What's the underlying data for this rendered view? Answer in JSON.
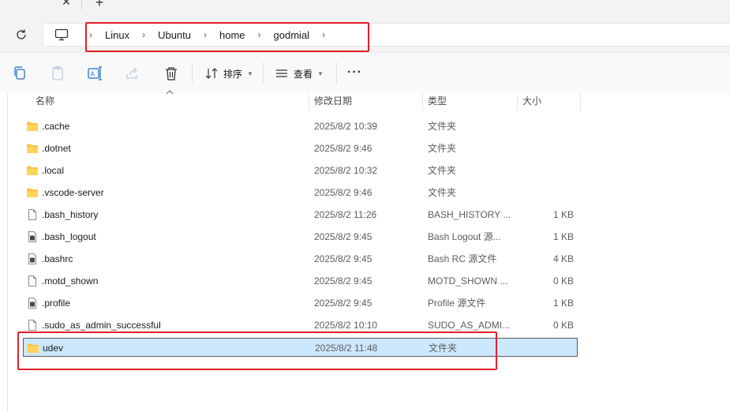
{
  "tabs": {
    "close_glyph": "✕",
    "new_glyph": "+"
  },
  "breadcrumb": {
    "items": [
      "Linux",
      "Ubuntu",
      "home",
      "godmial"
    ],
    "separator": "›"
  },
  "toolbar": {
    "sort_label": "排序",
    "view_label": "查看",
    "more_glyph": "···",
    "icons": [
      "copy-icon",
      "paste-icon",
      "rename-icon",
      "share-icon",
      "delete-icon",
      "sort-icon",
      "view-icon"
    ]
  },
  "columns": {
    "name": "名称",
    "date": "修改日期",
    "type": "类型",
    "size": "大小"
  },
  "files": [
    {
      "name": ".cache",
      "date": "2025/8/2 10:39",
      "type": "文件夹",
      "size": "",
      "icon": "folder-icon"
    },
    {
      "name": ".dotnet",
      "date": "2025/8/2 9:46",
      "type": "文件夹",
      "size": "",
      "icon": "folder-icon"
    },
    {
      "name": ".local",
      "date": "2025/8/2 10:32",
      "type": "文件夹",
      "size": "",
      "icon": "folder-icon"
    },
    {
      "name": ".vscode-server",
      "date": "2025/8/2 9:46",
      "type": "文件夹",
      "size": "",
      "icon": "folder-icon"
    },
    {
      "name": ".bash_history",
      "date": "2025/8/2 11:26",
      "type": "BASH_HISTORY ...",
      "size": "1 KB",
      "icon": "file-icon"
    },
    {
      "name": ".bash_logout",
      "date": "2025/8/2 9:45",
      "type": "Bash Logout 源...",
      "size": "1 KB",
      "icon": "source-file-icon"
    },
    {
      "name": ".bashrc",
      "date": "2025/8/2 9:45",
      "type": "Bash RC 源文件",
      "size": "4 KB",
      "icon": "source-file-icon"
    },
    {
      "name": ".motd_shown",
      "date": "2025/8/2 9:45",
      "type": "MOTD_SHOWN ...",
      "size": "0 KB",
      "icon": "file-icon"
    },
    {
      "name": ".profile",
      "date": "2025/8/2 9:45",
      "type": "Profile 源文件",
      "size": "1 KB",
      "icon": "source-file-icon"
    },
    {
      "name": ".sudo_as_admin_successful",
      "date": "2025/8/2 10:10",
      "type": "SUDO_AS_ADMI...",
      "size": "0 KB",
      "icon": "file-icon"
    },
    {
      "name": "udev",
      "date": "2025/8/2 11:48",
      "type": "文件夹",
      "size": "",
      "icon": "folder-icon",
      "selected": true
    }
  ],
  "colors": {
    "selection": "#cce8ff",
    "highlight_box": "#e0202a",
    "folder": "#f8c644"
  }
}
